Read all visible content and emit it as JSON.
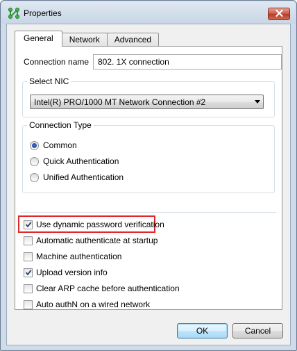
{
  "window": {
    "title": "Properties",
    "icon": "network-nodes-icon",
    "close_icon": "close-icon"
  },
  "tabs": [
    {
      "label": "General",
      "active": true
    },
    {
      "label": "Network",
      "active": false
    },
    {
      "label": "Advanced",
      "active": false
    }
  ],
  "connection": {
    "label": "Connection name",
    "value": "802. 1X connection"
  },
  "nic": {
    "legend": "Select NIC",
    "selected": "Intel(R) PRO/1000 MT Network Connection #2"
  },
  "connection_type": {
    "legend": "Connection Type",
    "options": [
      {
        "label": "Common",
        "selected": true
      },
      {
        "label": "Quick Authentication",
        "selected": false
      },
      {
        "label": "Unified Authentication",
        "selected": false
      }
    ]
  },
  "options": [
    {
      "label": "Use dynamic password verification",
      "checked": true,
      "highlighted": true
    },
    {
      "label": "Automatic authenticate at startup",
      "checked": false
    },
    {
      "label": "Machine authentication",
      "checked": false
    },
    {
      "label": "Upload version info",
      "checked": true
    },
    {
      "label": "Clear ARP cache before authentication",
      "checked": false
    },
    {
      "label": "Auto authN on a wired network",
      "checked": false
    }
  ],
  "buttons": {
    "ok": "OK",
    "cancel": "Cancel"
  },
  "colors": {
    "highlight": "#e0272c",
    "icon_green": "#2e9a3a"
  }
}
